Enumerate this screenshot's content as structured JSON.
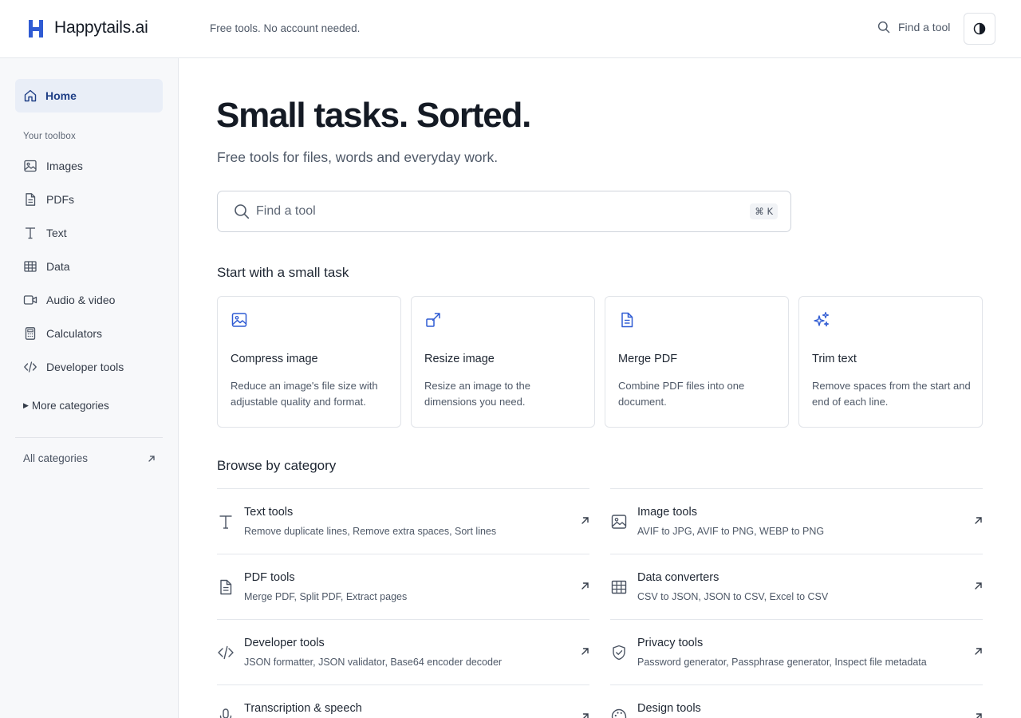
{
  "header": {
    "logo_text": "Happytails.ai",
    "tagline": "Free tools. No account needed.",
    "search_label": "Find a tool"
  },
  "sidebar": {
    "home": "Home",
    "group_label": "Your toolbox",
    "items": [
      {
        "label": "Images",
        "icon": "image-icon"
      },
      {
        "label": "PDFs",
        "icon": "document-icon"
      },
      {
        "label": "Text",
        "icon": "text-icon"
      },
      {
        "label": "Data",
        "icon": "table-icon"
      },
      {
        "label": "Audio & video",
        "icon": "video-icon"
      },
      {
        "label": "Calculators",
        "icon": "calculator-icon"
      },
      {
        "label": "Developer tools",
        "icon": "code-icon"
      }
    ],
    "more": "More categories",
    "all_categories": "All categories"
  },
  "hero": {
    "title": "Small tasks. Sorted.",
    "subtitle": "Free tools for files, words and everyday work.",
    "search_placeholder": "Find a tool",
    "shortcut": "⌘ K"
  },
  "tasks": {
    "title": "Start with a small task",
    "cards": [
      {
        "title": "Compress image",
        "desc": "Reduce an image's file size with adjustable quality and format.",
        "icon": "image-icon"
      },
      {
        "title": "Resize image",
        "desc": "Resize an image to the dimensions you need.",
        "icon": "resize-icon"
      },
      {
        "title": "Merge PDF",
        "desc": "Combine PDF files into one document.",
        "icon": "document-icon"
      },
      {
        "title": "Trim text",
        "desc": "Remove spaces from the start and end of each line.",
        "icon": "sparkles-icon"
      }
    ]
  },
  "browse": {
    "title": "Browse by category",
    "categories": [
      {
        "title": "Text tools",
        "sub": "Remove duplicate lines, Remove extra spaces, Sort lines",
        "icon": "text-icon"
      },
      {
        "title": "Image tools",
        "sub": "AVIF to JPG, AVIF to PNG, WEBP to PNG",
        "icon": "image-icon"
      },
      {
        "title": "PDF tools",
        "sub": "Merge PDF, Split PDF, Extract pages",
        "icon": "document-icon"
      },
      {
        "title": "Data converters",
        "sub": "CSV to JSON, JSON to CSV, Excel to CSV",
        "icon": "table-icon"
      },
      {
        "title": "Developer tools",
        "sub": "JSON formatter, JSON validator, Base64 encoder decoder",
        "icon": "code-icon"
      },
      {
        "title": "Privacy tools",
        "sub": "Password generator, Passphrase generator, Inspect file metadata",
        "icon": "shield-check-icon"
      },
      {
        "title": "Transcription & speech",
        "sub": "",
        "icon": "microphone-icon"
      },
      {
        "title": "Design tools",
        "sub": "",
        "icon": "palette-icon"
      }
    ]
  },
  "colors": {
    "accent": "#2f5bd3",
    "text": "#1f2733",
    "muted": "#4e5867",
    "sidebar_bg": "#f7f8fa",
    "active_bg": "#e9eef7"
  }
}
